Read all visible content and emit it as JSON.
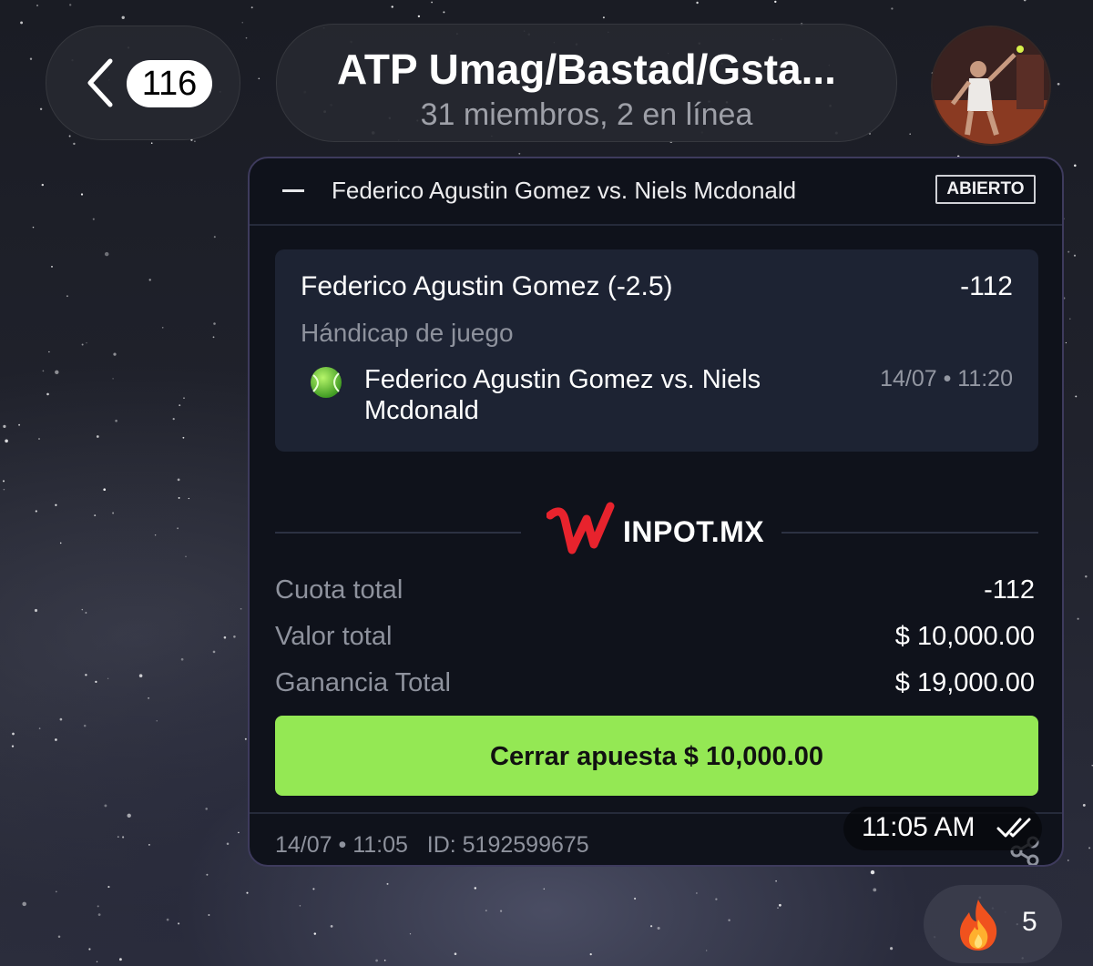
{
  "header": {
    "unread_count": "116",
    "chat_title": "ATP Umag/Bastad/Gsta...",
    "chat_subtitle": "31 miembros, 2 en línea"
  },
  "bet_card": {
    "match_title": "Federico Agustin Gomez vs. Niels Mcdonald",
    "status": "ABIERTO",
    "selection": {
      "name": "Federico Agustin Gomez (-2.5)",
      "odds": "-112",
      "market": "Hándicap de juego",
      "event_line1": "Federico Agustin Gomez vs. Niels",
      "event_line2": "Mcdonald",
      "event_time": "14/07 • 11:20"
    },
    "brand_text": "INPOT.MX",
    "summary": [
      {
        "label": "Cuota total",
        "value": "-112"
      },
      {
        "label": "Valor total",
        "value": "$ 10,000.00"
      },
      {
        "label": "Ganancia Total",
        "value": "$ 19,000.00"
      }
    ],
    "cta_label": "Cerrar apuesta $ 10,000.00",
    "footer_meta": "14/07 • 11:05   ID: 5192599675"
  },
  "message": {
    "time": "11:05 AM"
  },
  "reaction": {
    "emoji": "fire-emoji",
    "count": "5"
  },
  "colors": {
    "accent_green": "#94e854",
    "brand_red": "#e8232d",
    "card_bg": "#0f121b",
    "selection_bg": "#1d2333"
  }
}
